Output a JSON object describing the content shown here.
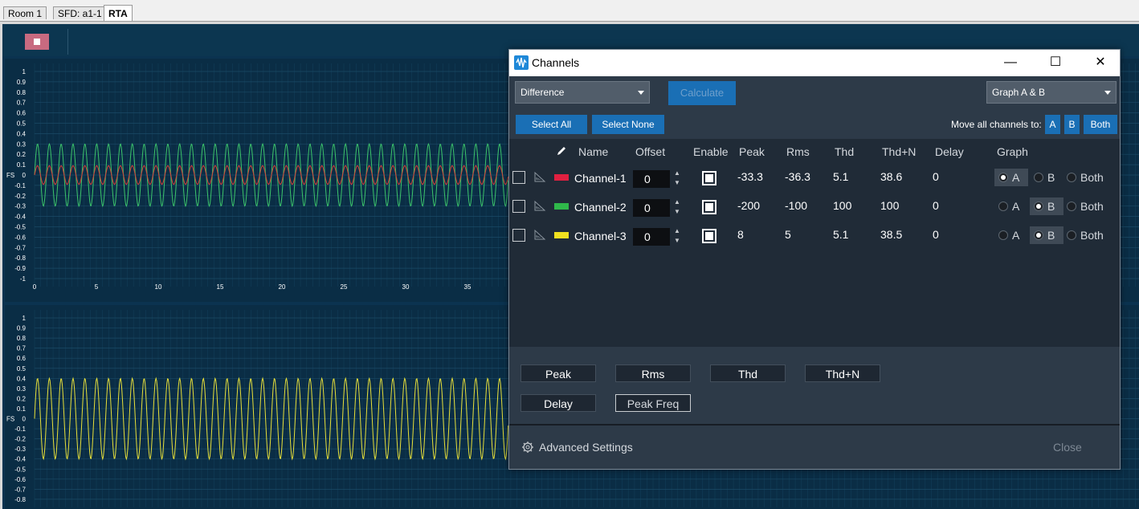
{
  "tabs": [
    {
      "label": "Room 1",
      "active": false
    },
    {
      "label": "SFD: a1-1",
      "active": false
    },
    {
      "label": "RTA",
      "active": true
    }
  ],
  "toolbar": {
    "stop_icon": "stop-icon"
  },
  "graphs": [
    {
      "id": "graph-a",
      "y_ticks": [
        "1",
        "0.9",
        "0.8",
        "0.7",
        "0.6",
        "0.5",
        "0.4",
        "0.3",
        "0.2",
        "0.1",
        "0",
        "-0.1",
        "-0.2",
        "-0.3",
        "-0.4",
        "-0.5",
        "-0.6",
        "-0.7",
        "-0.8",
        "-0.9",
        "-1"
      ],
      "y_unit": "FS",
      "x_ticks": [
        "0",
        "5",
        "10",
        "15",
        "20",
        "25",
        "30",
        "35"
      ],
      "series": [
        {
          "color": "#3cc46a",
          "amplitude": 0.3,
          "cycles": 40
        },
        {
          "color": "#d8433a",
          "amplitude": 0.09,
          "cycles": 40
        }
      ]
    },
    {
      "id": "graph-b",
      "y_ticks": [
        "1",
        "0.9",
        "0.8",
        "0.7",
        "0.6",
        "0.5",
        "0.4",
        "0.3",
        "0.2",
        "0.1",
        "0",
        "-0.1",
        "-0.2",
        "-0.3",
        "-0.4",
        "-0.5",
        "-0.6",
        "-0.7",
        "-0.8"
      ],
      "y_unit": "FS",
      "series": [
        {
          "color": "#e8e03a",
          "amplitude": 0.4,
          "cycles": 40
        }
      ]
    }
  ],
  "dialog": {
    "title": "Channels",
    "window_buttons": {
      "minimize": "—",
      "maximize": "☐",
      "close": "✕"
    },
    "mode_dropdown": "Difference",
    "calculate_label": "Calculate",
    "graph_dropdown": "Graph A & B",
    "select_all": "Select All",
    "select_none": "Select None",
    "move_all_label": "Move all channels to:",
    "move_buttons": [
      "A",
      "B",
      "Both"
    ],
    "headers": {
      "name": "Name",
      "offset": "Offset",
      "enable": "Enable",
      "peak": "Peak",
      "rms": "Rms",
      "thd": "Thd",
      "thdn": "Thd+N",
      "delay": "Delay",
      "graph": "Graph"
    },
    "channels": [
      {
        "name": "Channel-1",
        "color": "#e02040",
        "offset": "0",
        "peak": "-33.3",
        "rms": "-36.3",
        "thd": "5.1",
        "thdn": "38.6",
        "delay": "0",
        "graph": "A"
      },
      {
        "name": "Channel-2",
        "color": "#2fb84a",
        "offset": "0",
        "peak": "-200",
        "rms": "-100",
        "thd": "100",
        "thdn": "100",
        "delay": "0",
        "graph": "B"
      },
      {
        "name": "Channel-3",
        "color": "#f0e020",
        "offset": "0",
        "peak": "8",
        "rms": "5",
        "thd": "5.1",
        "thdn": "38.5",
        "delay": "0",
        "graph": "B"
      }
    ],
    "graph_options": [
      "A",
      "B",
      "Both"
    ],
    "stat_buttons": [
      "Peak",
      "Rms",
      "Thd",
      "Thd+N",
      "Delay",
      "Peak Freq"
    ],
    "advanced_settings": "Advanced Settings",
    "close_label": "Close"
  }
}
